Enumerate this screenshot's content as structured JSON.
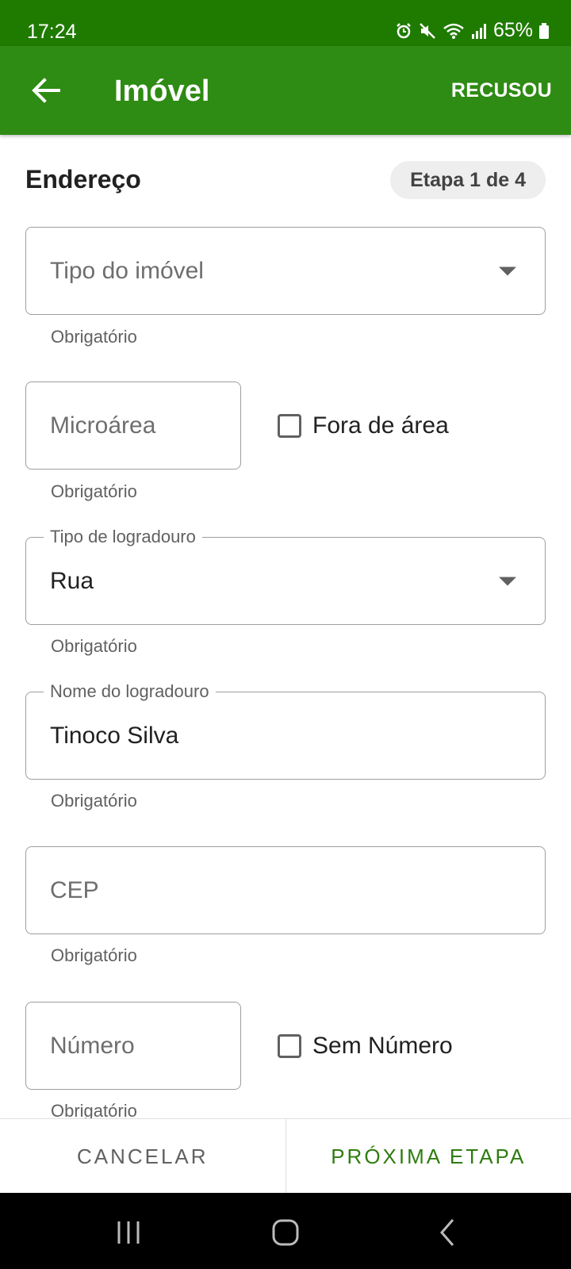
{
  "status_bar": {
    "time": "17:24",
    "battery": "65%"
  },
  "app_bar": {
    "title": "Imóvel",
    "action": "RECUSOU"
  },
  "section": {
    "title": "Endereço",
    "step": "Etapa 1 de 4"
  },
  "fields": {
    "tipo_imovel": {
      "placeholder": "Tipo do imóvel",
      "helper": "Obrigatório"
    },
    "microarea": {
      "placeholder": "Microárea",
      "helper": "Obrigatório"
    },
    "fora_area": {
      "label": "Fora de área",
      "checked": false
    },
    "tipo_logradouro": {
      "label": "Tipo de logradouro",
      "value": "Rua",
      "helper": "Obrigatório"
    },
    "nome_logradouro": {
      "label": "Nome do logradouro",
      "value": "Tinoco Silva",
      "helper": "Obrigatório"
    },
    "cep": {
      "placeholder": "CEP",
      "helper": "Obrigatório"
    },
    "numero": {
      "placeholder": "Número",
      "helper": "Obrigatório"
    },
    "sem_numero": {
      "label": "Sem Número",
      "checked": false
    }
  },
  "actions": {
    "cancel": "CANCELAR",
    "next": "PRÓXIMA ETAPA"
  },
  "icons": {
    "back": "arrow-left-icon",
    "dropdown": "dropdown-arrow-icon",
    "nav_recents": "recents-icon",
    "nav_home": "home-icon",
    "nav_back": "nav-back-icon"
  },
  "colors": {
    "status_bar": "#1f7a00",
    "app_bar": "#2e8b13",
    "accent": "#2e7d0f"
  }
}
